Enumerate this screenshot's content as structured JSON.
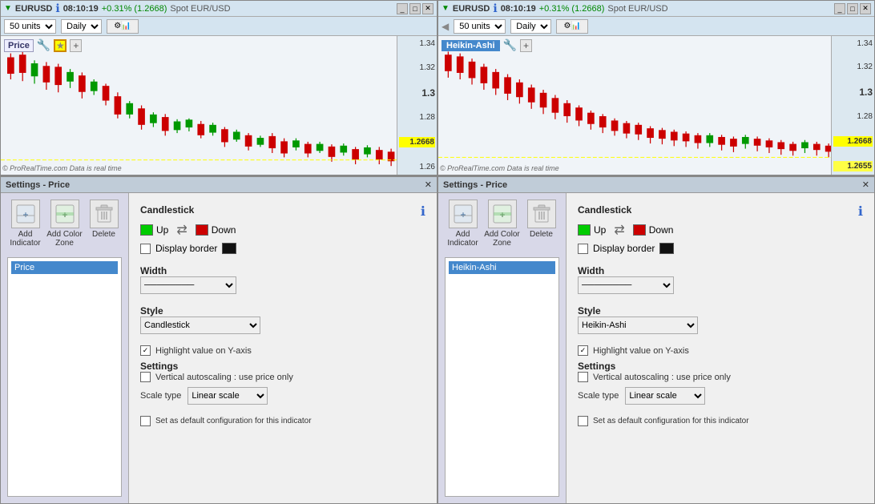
{
  "charts": [
    {
      "id": "chart-left",
      "title": "EURUSD",
      "info_icon": "ℹ",
      "time": "08:10:19",
      "change": "+0.31% (1.2668)",
      "spot_label": "Spot EUR/USD",
      "units": "50 units",
      "period": "Daily",
      "inner_label": "Price",
      "price_current": "1.2668",
      "price_axis": [
        "1.34",
        "1.32",
        "1.3",
        "1.28",
        "1.2668",
        "1.26"
      ],
      "watermark": "© ProRealTime.com  Data is real time",
      "style_name": "Candlestick"
    },
    {
      "id": "chart-right",
      "title": "EURUSD",
      "info_icon": "ℹ",
      "time": "08:10:19",
      "change": "+0.31% (1.2668)",
      "spot_label": "Spot EUR/USD",
      "units": "50 units",
      "period": "Daily",
      "inner_label": "Heikin-Ashi",
      "price_current": "1.2668",
      "price_current2": "1.2655",
      "price_axis": [
        "1.34",
        "1.32",
        "1.3",
        "1.28",
        "1.2668",
        "1.2655"
      ],
      "watermark": "© ProRealTime.com  Data is real time",
      "style_name": "Heikin-Ashi"
    }
  ],
  "settings": [
    {
      "id": "settings-left",
      "title": "Settings - Price",
      "list_item": "Price",
      "candlestick_section": "Candlestick",
      "up_label": "Up",
      "down_label": "Down",
      "display_border_label": "Display border",
      "width_section": "Width",
      "style_section": "Style",
      "style_value": "Candlestick",
      "highlight_label": "Highlight value on Y-axis",
      "settings_section": "Settings",
      "autoscale_label": "Vertical autoscaling : use price only",
      "scale_label": "Scale type",
      "scale_value": "Linear scale",
      "default_label": "Set as default configuration for this indicator",
      "add_indicator_label": "Add Indicator",
      "add_color_zone_label": "Add Color Zone",
      "delete_label": "Delete"
    },
    {
      "id": "settings-right",
      "title": "Settings - Price",
      "list_item": "Heikin-Ashi",
      "candlestick_section": "Candlestick",
      "up_label": "Up",
      "down_label": "Down",
      "display_border_label": "Display border",
      "width_section": "Width",
      "style_section": "Style",
      "style_value": "Heikin-Ashi",
      "highlight_label": "Highlight value on Y-axis",
      "settings_section": "Settings",
      "autoscale_label": "Vertical autoscaling : use price only",
      "scale_label": "Scale type",
      "scale_value": "Linear scale",
      "default_label": "Set as default configuration for this indicator",
      "add_indicator_label": "Add Indicator",
      "add_color_zone_label": "Add Color Zone",
      "delete_label": "Delete"
    }
  ],
  "window_buttons": {
    "minimize": "_",
    "maximize": "□",
    "close": "✕"
  }
}
